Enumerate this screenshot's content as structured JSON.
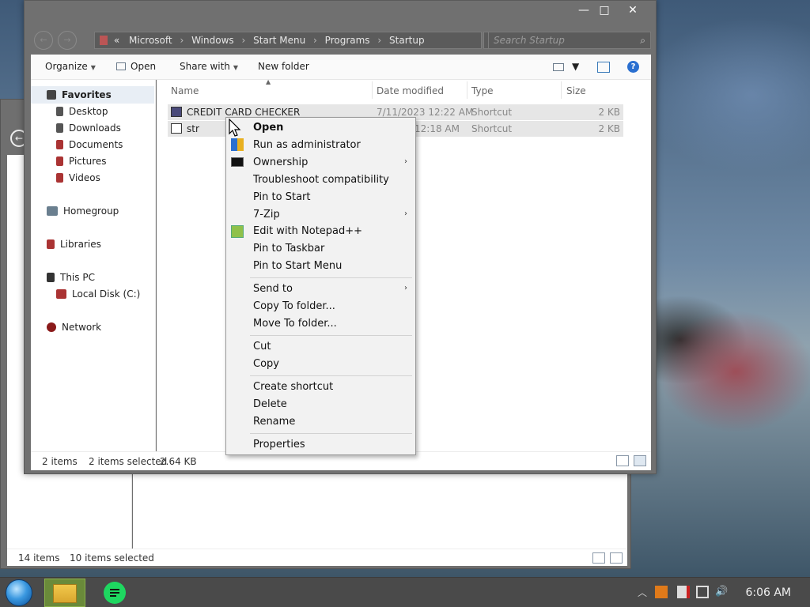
{
  "bg_window": {
    "status_count": "14 items",
    "status_selected": "10 items selected"
  },
  "window": {
    "controls": {
      "minimize": "—",
      "maximize": "□",
      "close": "✕"
    },
    "address": {
      "overflow": "«",
      "path": [
        "Microsoft",
        "Windows",
        "Start Menu",
        "Programs",
        "Startup"
      ],
      "separator": "›"
    },
    "search_placeholder": "Search Startup",
    "toolbar": {
      "organize": "Organize",
      "open": "Open",
      "share_with": "Share with",
      "new_folder": "New folder"
    },
    "nav": {
      "favorites": "Favorites",
      "desktop": "Desktop",
      "downloads": "Downloads",
      "documents": "Documents",
      "pictures": "Pictures",
      "videos": "Videos",
      "homegroup": "Homegroup",
      "libraries": "Libraries",
      "this_pc": "This PC",
      "local_disk": "Local Disk (C:)",
      "network": "Network"
    },
    "columns": {
      "name": "Name",
      "date_modified": "Date modified",
      "type": "Type",
      "size": "Size"
    },
    "files": [
      {
        "name": "CREDIT CARD CHECKER",
        "date": "7/11/2023 12:22 AM",
        "type": "Shortcut",
        "size": "2 KB"
      },
      {
        "name": "str",
        "date": "12:18 AM",
        "type": "Shortcut",
        "size": "2 KB"
      }
    ],
    "status": {
      "count": "2 items",
      "selected": "2 items selected",
      "size": "2.64 KB"
    }
  },
  "context_menu": {
    "open": "Open",
    "run_as_admin": "Run as administrator",
    "ownership": "Ownership",
    "troubleshoot": "Troubleshoot compatibility",
    "pin_to_start": "Pin to Start",
    "seven_zip": "7-Zip",
    "edit_notepad": "Edit with Notepad++",
    "pin_taskbar": "Pin to Taskbar",
    "pin_start_menu": "Pin to Start Menu",
    "send_to": "Send to",
    "copy_to_folder": "Copy To folder...",
    "move_to_folder": "Move To folder...",
    "cut": "Cut",
    "copy": "Copy",
    "create_shortcut": "Create shortcut",
    "delete": "Delete",
    "rename": "Rename",
    "properties": "Properties",
    "submenu_arrow": "›"
  },
  "taskbar": {
    "clock": "6:06 AM"
  },
  "colors": {
    "accent": "#3a98e0",
    "window_chrome": "#707070",
    "selection": "#e6e6e6"
  }
}
